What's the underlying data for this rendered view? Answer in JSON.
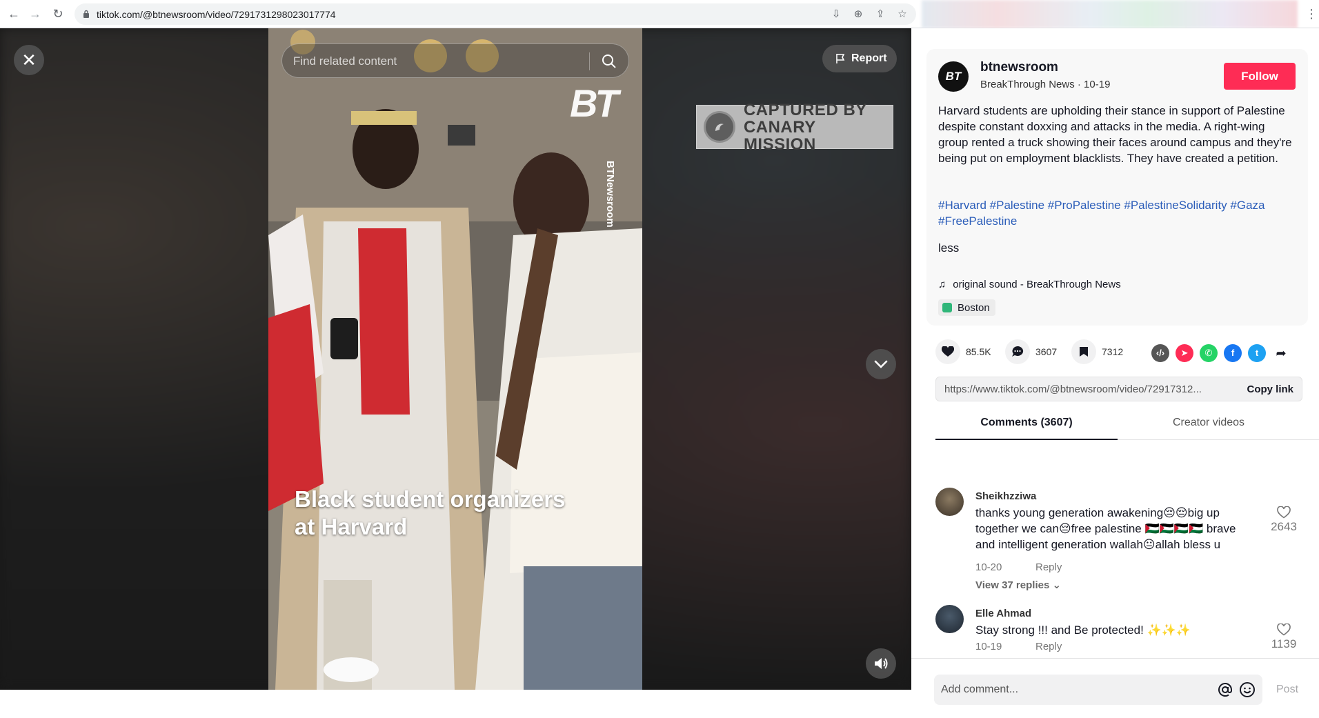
{
  "browser": {
    "url": "tiktok.com/@btnewsroom/video/7291731298023017774"
  },
  "video": {
    "search_placeholder": "Find related content",
    "report_label": "Report",
    "caption": "Black student organizers at Harvard",
    "banner_line1": "CAPTURED BY",
    "banner_line2": "CANARY MISSION",
    "watermark_logo": "BT",
    "watermark_handle": "BTNewsroom"
  },
  "author": {
    "avatar_text": "BT",
    "username": "btnewsroom",
    "subtitle": "BreakThrough News · 10-19",
    "follow_label": "Follow"
  },
  "post": {
    "description": "Harvard students are upholding their stance in support of Palestine despite constant doxxing and attacks in the media. A right-wing group rented a truck showing their faces around campus and they're being put on employment blacklists. They have created a petition.",
    "hashtags": [
      "#Harvard",
      "#Palestine",
      "#ProPalestine",
      "#PalestineSolidarity",
      "#Gaza",
      "#FreePalestine"
    ],
    "less_label": "less",
    "sound": "original sound - BreakThrough News",
    "location": "Boston"
  },
  "actions": {
    "likes": "85.5K",
    "comments": "3607",
    "saves": "7312",
    "share_colors": {
      "embed": "#565656",
      "send": "#fe2c55",
      "whatsapp": "#25d366",
      "facebook": "#1877f2",
      "twitter": "#1da1f2"
    }
  },
  "share": {
    "link": "https://www.tiktok.com/@btnewsroom/video/72917312...",
    "copy_label": "Copy link"
  },
  "tabs": [
    {
      "label": "Comments (3607)",
      "active": true
    },
    {
      "label": "Creator videos",
      "active": false
    }
  ],
  "comments": [
    {
      "user": "Sheikhzziwa",
      "text": "thanks young generation awakening😔😔big up together we can😔free palestine 🇵🇸🇵🇸🇵🇸🇵🇸 brave and intelligent generation wallah😐allah bless u",
      "date": "10-20",
      "reply_label": "Reply",
      "view_replies": "View 37 replies ⌄",
      "likes": "2643"
    },
    {
      "user": "Elle Ahmad",
      "text": "Stay strong !!! and Be protected! ✨✨✨",
      "date": "10-19",
      "reply_label": "Reply",
      "likes": "1139"
    }
  ],
  "composer": {
    "placeholder": "Add comment...",
    "post_label": "Post"
  }
}
